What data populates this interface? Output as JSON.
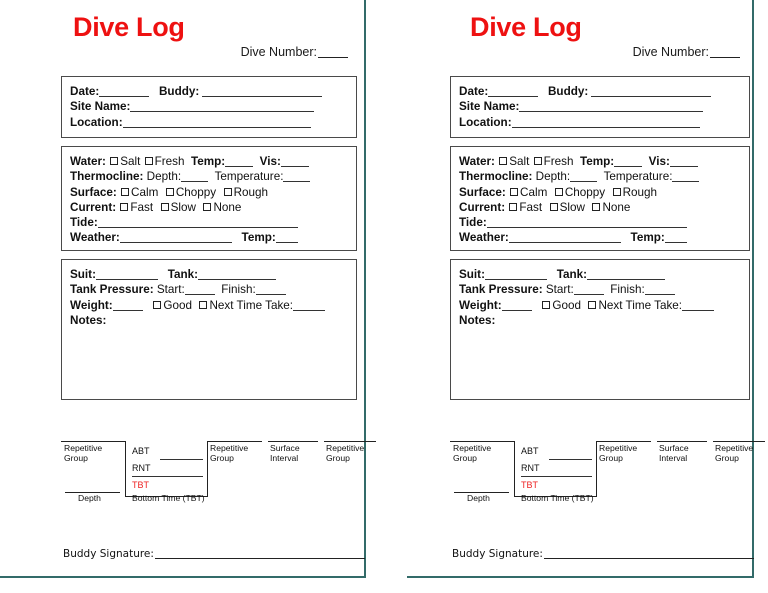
{
  "document": {
    "title": "Dive Log",
    "title_color": "#ee1111",
    "page_border_color": "#336b69",
    "accent_red": "#ee2222",
    "pages": 2
  },
  "header": {
    "title": "Dive Log",
    "dive_number_label": "Dive Number:"
  },
  "identification": {
    "date_label": "Date:",
    "buddy_label": "Buddy:",
    "site_name_label": "Site Name:",
    "location_label": "Location:"
  },
  "conditions": {
    "water_label": "Water:",
    "water_options": [
      "Salt",
      "Fresh"
    ],
    "temp_label": "Temp:",
    "vis_label": "Vis:",
    "thermocline_label": "Thermocline:",
    "thermocline_depth_label": "Depth:",
    "thermocline_temperature_label": "Temperature:",
    "surface_label": "Surface:",
    "surface_options": [
      "Calm",
      "Choppy",
      "Rough"
    ],
    "current_label": "Current:",
    "current_options": [
      "Fast",
      "Slow",
      "None"
    ],
    "tide_label": "Tide:",
    "weather_label": "Weather:",
    "weather_temp_label": "Temp:"
  },
  "equipment": {
    "suit_label": "Suit:",
    "tank_label": "Tank:",
    "tank_pressure_label": "Tank Pressure:",
    "start_label": "Start:",
    "finish_label": "Finish:",
    "weight_label": "Weight:",
    "good_label": "Good",
    "next_time_take_label": "Next Time Take:",
    "notes_label": "Notes:"
  },
  "profile": {
    "repetitive_group_label": "Repetitive\nGroup",
    "abt_label": "ABT",
    "rnt_label": "RNT",
    "tbt_label": "TBT",
    "depth_label": "Depth",
    "bottom_time_label": "Bottom Time (TBT)",
    "repetitive_group_2_label": "Repetitive\nGroup",
    "surface_interval_label": "Surface\nInterval",
    "repetitive_group_3_label": "Repetitive\nGroup"
  },
  "footer": {
    "buddy_signature_label": "Buddy Signature:"
  }
}
